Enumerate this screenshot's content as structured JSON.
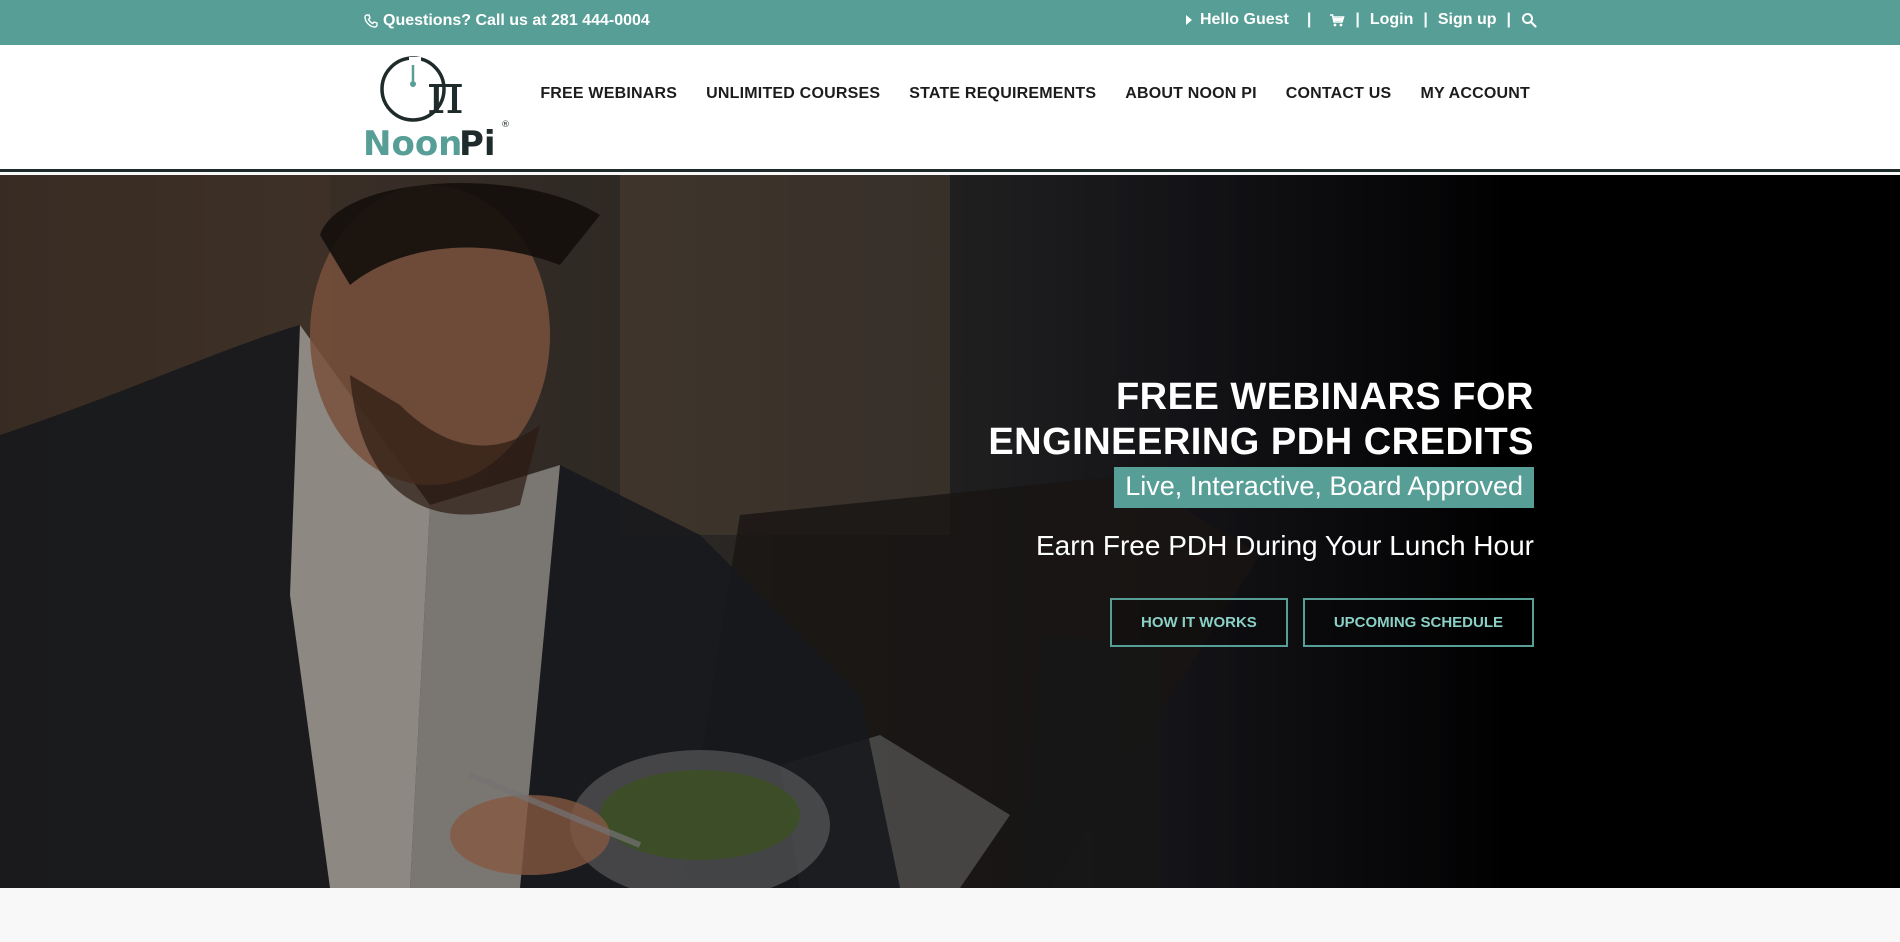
{
  "topbar": {
    "phone_text": "Questions? Call us at 281 444-0004",
    "greeting": "Hello Guest",
    "login": "Login",
    "signup": "Sign up",
    "separator": "|",
    "icons": [
      "phone-icon",
      "caret-right-icon",
      "cart-icon",
      "search-icon"
    ],
    "bg_color": "#579e96"
  },
  "header": {
    "logo_text": "NoonPi",
    "logo_symbol": "π",
    "nav": [
      "FREE WEBINARS",
      "UNLIMITED COURSES",
      "STATE REQUIREMENTS",
      "ABOUT NOON PI",
      "CONTACT US",
      "MY ACCOUNT"
    ]
  },
  "hero": {
    "title_line1": "FREE WEBINARS FOR",
    "title_line2": "ENGINEERING PDH CREDITS",
    "tagline": "Live, Interactive, Board Approved",
    "subtitle": "Earn Free PDH During Your Lunch Hour",
    "buttons": [
      "HOW IT WORKS",
      "UPCOMING SCHEDULE"
    ],
    "accent_color": "#579e96"
  }
}
